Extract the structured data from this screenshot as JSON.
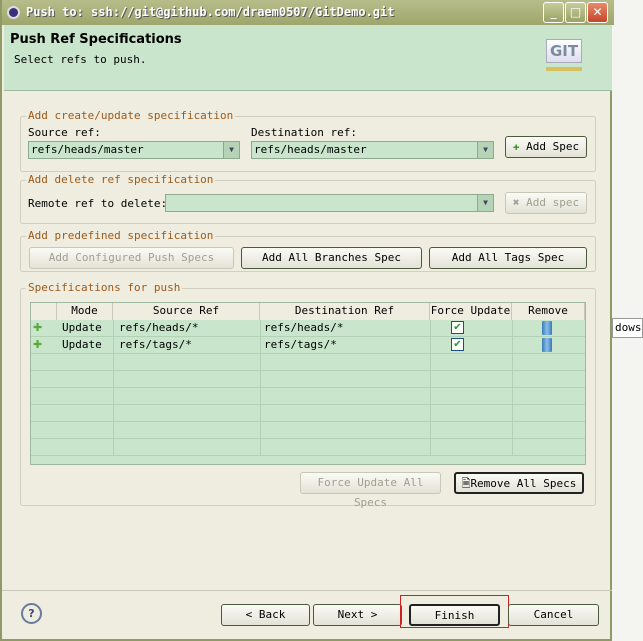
{
  "window": {
    "title": "Push to: ssh://git@github.com/draem0507/GitDemo.git",
    "minimize": "_",
    "maximize": "□",
    "close": "✕"
  },
  "header": {
    "title": "Push Ref Specifications",
    "subtitle": "Select refs to push.",
    "logo": "GIT"
  },
  "create_group": {
    "title": "Add create/update specification",
    "source_label": "Source ref:",
    "source_value": "refs/heads/master",
    "dest_label": "Destination ref:",
    "dest_value": "refs/heads/master",
    "add_button": "Add Spec"
  },
  "delete_group": {
    "title": "Add delete ref specification",
    "remote_label": "Remote ref to delete:",
    "remote_value": "",
    "add_button": "Add spec"
  },
  "predefined_group": {
    "title": "Add predefined specification",
    "configured": "Add Configured Push Specs",
    "branches": "Add All Branches Spec",
    "tags": "Add All Tags Spec"
  },
  "specs_group": {
    "title": "Specifications for push",
    "columns": [
      "Mode",
      "Source Ref",
      "Destination Ref",
      "Force Update",
      "Remove"
    ],
    "rows": [
      {
        "mode": "Update",
        "source": "refs/heads/*",
        "dest": "refs/heads/*",
        "force": true
      },
      {
        "mode": "Update",
        "source": "refs/tags/*",
        "dest": "refs/tags/*",
        "force": true
      }
    ],
    "force_all": "Force Update All Specs",
    "remove_all": "Remove All Specs"
  },
  "footer": {
    "help": "?",
    "back": "< Back",
    "next": "Next >",
    "finish": "Finish",
    "cancel": "Cancel"
  },
  "background": {
    "tab_text": "dows"
  }
}
